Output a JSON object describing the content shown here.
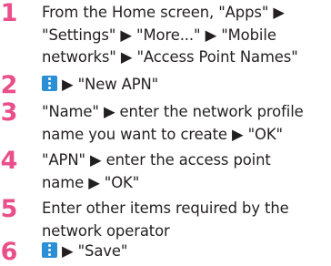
{
  "colors": {
    "step_number": "#e94f8a",
    "menu_icon": "#2b8fd6",
    "text": "#231f20"
  },
  "steps": [
    {
      "number": "1",
      "lines": [
        "From the Home screen, \"Apps\" ▶",
        "\"Settings\" ▶ \"More...\" ▶ \"Mobile",
        "networks\" ▶ \"Access Point Names\""
      ]
    },
    {
      "number": "2",
      "icon": "menu-icon",
      "lines": [
        "▶ \"New APN\""
      ]
    },
    {
      "number": "3",
      "lines": [
        "\"Name\" ▶ enter the network profile",
        "name you want to create ▶ \"OK\""
      ]
    },
    {
      "number": "4",
      "lines": [
        "\"APN\" ▶ enter the access point",
        "name ▶ \"OK\""
      ]
    },
    {
      "number": "5",
      "lines": [
        "Enter other items required by the",
        "network operator"
      ]
    },
    {
      "number": "6",
      "icon": "menu-icon",
      "lines": [
        "▶ \"Save\""
      ]
    }
  ]
}
